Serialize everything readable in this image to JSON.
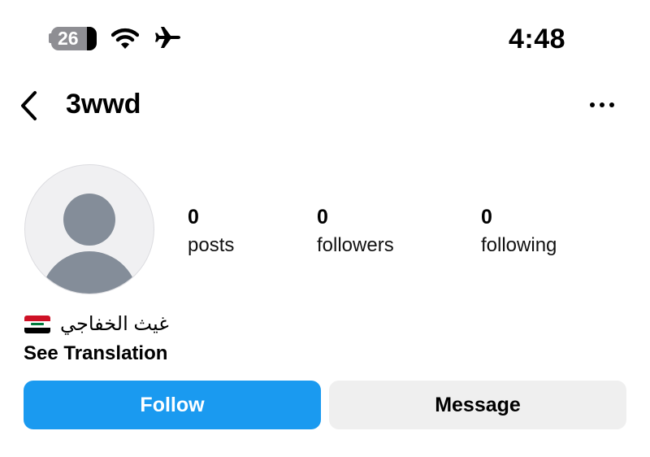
{
  "status_bar": {
    "battery_level": "26",
    "time": "4:48",
    "icons": [
      "battery-icon",
      "wifi-icon",
      "airplane-icon"
    ]
  },
  "header": {
    "back_icon": "chevron-left-icon",
    "username": "3wwd",
    "more_icon": "ellipsis-icon"
  },
  "profile": {
    "avatar_icon": "default-avatar-icon",
    "stats": [
      {
        "count": "0",
        "label": "posts"
      },
      {
        "count": "0",
        "label": "followers"
      },
      {
        "count": "0",
        "label": "following"
      }
    ],
    "bio": "غيث الخفاجي",
    "bio_flag": "iraq-flag-icon",
    "see_translation": "See Translation"
  },
  "actions": {
    "follow_label": "Follow",
    "message_label": "Message"
  },
  "colors": {
    "follow_bg": "#1a9af0",
    "message_bg": "#efefef",
    "avatar_silhouette": "#848d99"
  }
}
